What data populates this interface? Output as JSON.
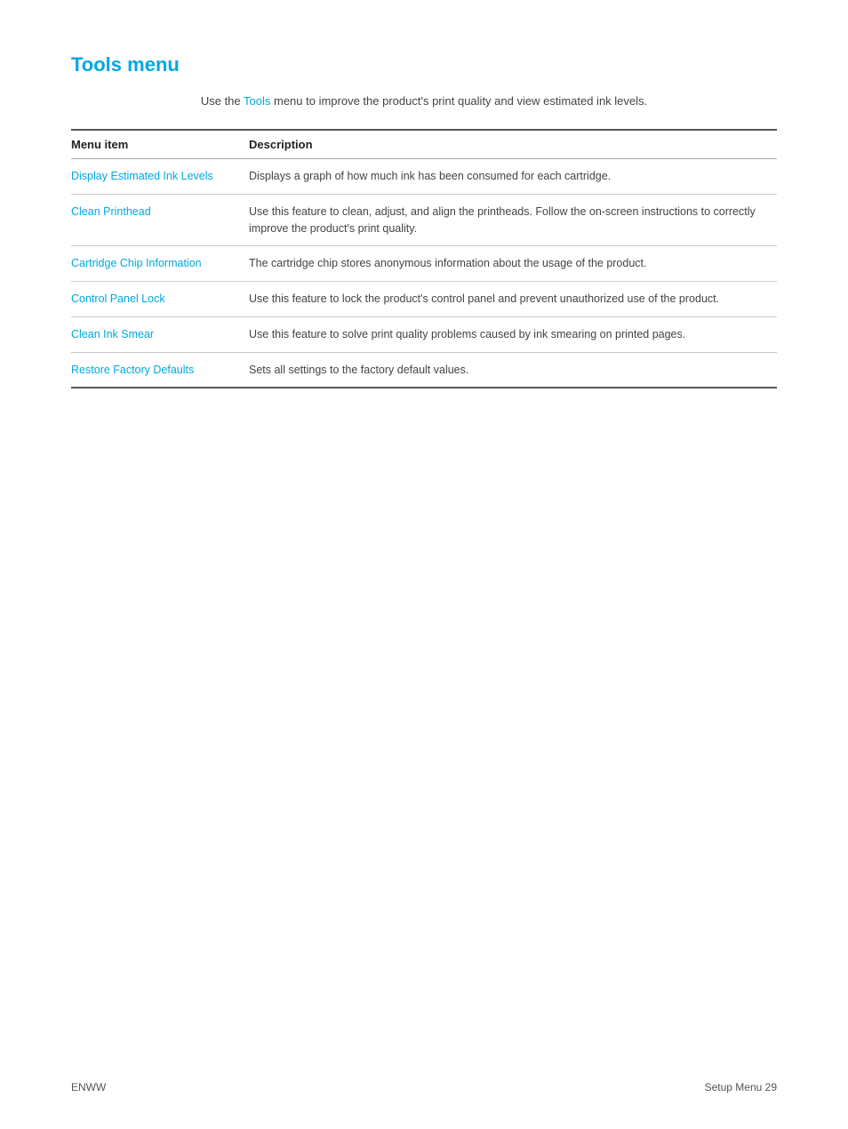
{
  "page": {
    "title": "Tools menu",
    "intro": {
      "text_before": "Use the ",
      "link_text": "Tools",
      "text_after": " menu to improve the product's print quality and view estimated ink levels."
    }
  },
  "table": {
    "headers": {
      "col1": "Menu item",
      "col2": "Description"
    },
    "rows": [
      {
        "menu_item": "Display Estimated Ink Levels",
        "description": "Displays a graph of how much ink has been consumed for each cartridge."
      },
      {
        "menu_item": "Clean Printhead",
        "description": "Use this feature to clean, adjust, and align the printheads. Follow the on-screen instructions to correctly improve the product's print quality."
      },
      {
        "menu_item": "Cartridge Chip Information",
        "description": "The cartridge chip stores anonymous information about the usage of the product."
      },
      {
        "menu_item": "Control Panel Lock",
        "description": "Use this feature to lock the product's control panel and prevent unauthorized use of the product."
      },
      {
        "menu_item": "Clean Ink Smear",
        "description": "Use this feature to solve print quality problems caused by ink smearing on printed pages."
      },
      {
        "menu_item": "Restore Factory Defaults",
        "description": "Sets all settings to the factory default values."
      }
    ]
  },
  "footer": {
    "left": "ENWW",
    "right": "Setup Menu      29"
  },
  "colors": {
    "link_blue": "#00a8e0",
    "title_blue": "#00a8e0"
  }
}
